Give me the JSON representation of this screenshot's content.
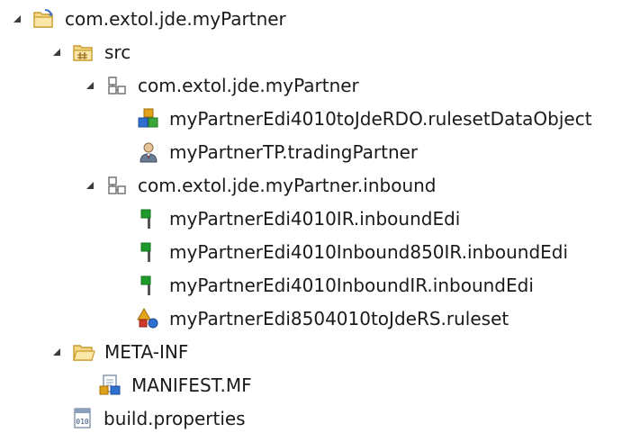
{
  "tree": {
    "project": {
      "label": "com.extol.jde.myPartner",
      "icon": "project-folder-icon",
      "expanded": true
    },
    "src": {
      "label": "src",
      "icon": "source-folder-icon",
      "expanded": true
    },
    "package_main": {
      "label": "com.extol.jde.myPartner",
      "icon": "package-icon",
      "expanded": true
    },
    "rdo_file": {
      "label": "myPartnerEdi4010toJdeRDO.rulesetDataObject",
      "icon": "ruleset-data-object-icon"
    },
    "tp_file": {
      "label": "myPartnerTP.tradingPartner",
      "icon": "trading-partner-icon"
    },
    "package_inbound": {
      "label": "com.extol.jde.myPartner.inbound",
      "icon": "package-icon",
      "expanded": true
    },
    "ir_file": {
      "label": "myPartnerEdi4010IR.inboundEdi",
      "icon": "inbound-edi-flag-icon"
    },
    "ir850_file": {
      "label": "myPartnerEdi4010Inbound850IR.inboundEdi",
      "icon": "inbound-edi-flag-icon"
    },
    "inbound_ir_file": {
      "label": "myPartnerEdi4010InboundIR.inboundEdi",
      "icon": "inbound-edi-flag-icon"
    },
    "rs_file": {
      "label": "myPartnerEdi8504010toJdeRS.ruleset",
      "icon": "ruleset-icon"
    },
    "meta_inf": {
      "label": "META-INF",
      "icon": "folder-icon",
      "expanded": true
    },
    "manifest": {
      "label": "MANIFEST.MF",
      "icon": "manifest-icon"
    },
    "build_props": {
      "label": "build.properties",
      "icon": "properties-file-icon"
    }
  },
  "colors": {
    "folder_fill": "#f6d889",
    "folder_stroke": "#c89a2c",
    "package_stroke": "#6b6b6b",
    "flag_green": "#1f9a2a",
    "twisty": "#3c3c3c"
  }
}
